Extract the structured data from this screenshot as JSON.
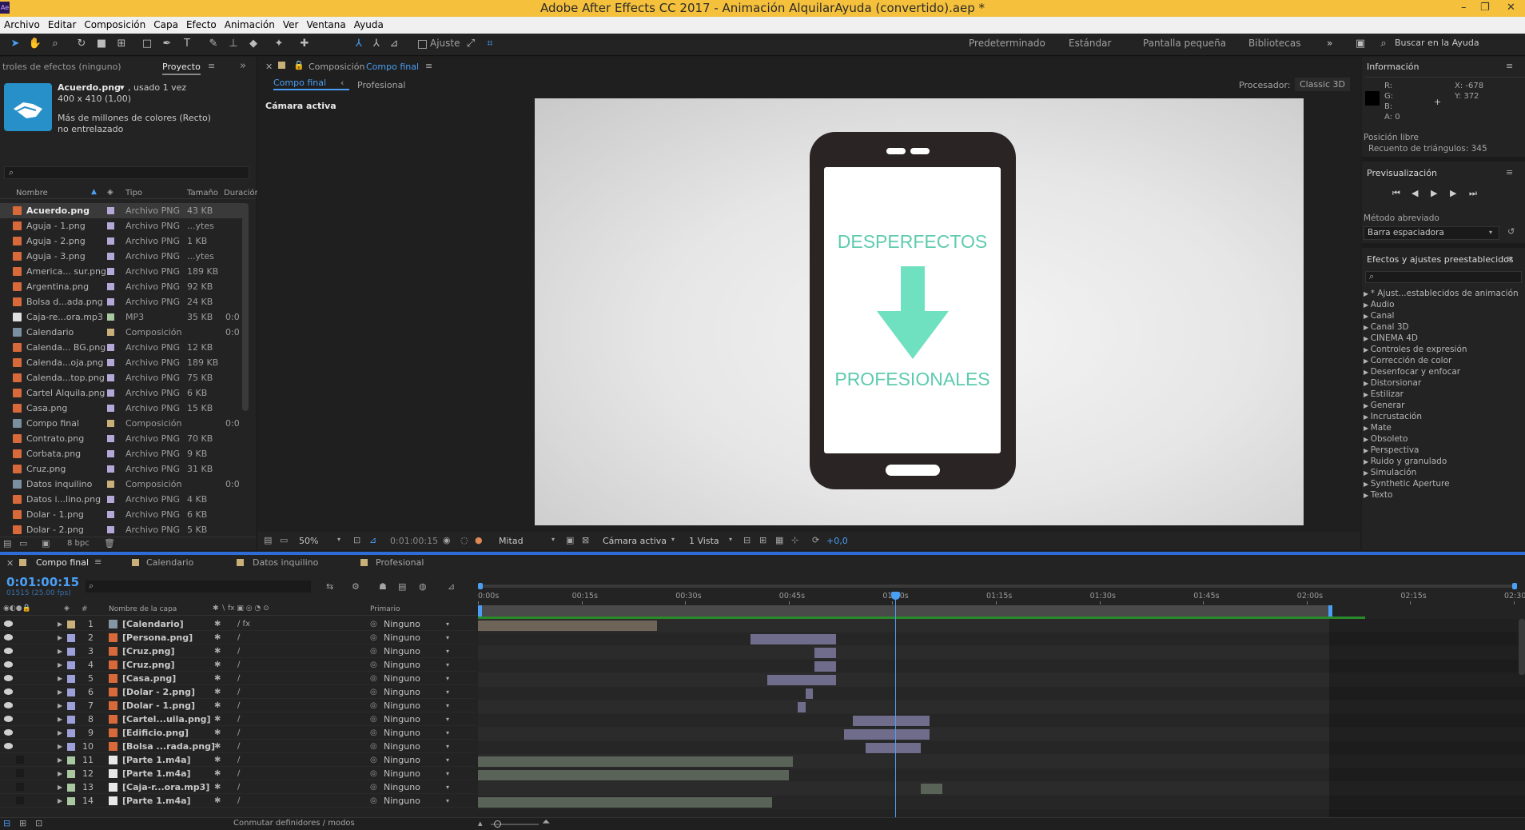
{
  "window": {
    "title": "Adobe After Effects CC 2017 - Animación AlquilarAyuda (convertido).aep *",
    "app_icon": "Ae"
  },
  "menu": [
    "Archivo",
    "Editar",
    "Composición",
    "Capa",
    "Efecto",
    "Animación",
    "Ver",
    "Ventana",
    "Ayuda"
  ],
  "toolbar": {
    "snap_label": "Ajuste",
    "workspaces": [
      "Predeterminado",
      "Estándar",
      "Pantalla pequeña",
      "Bibliotecas"
    ],
    "more": "»",
    "search_placeholder": "Buscar en la Ayuda"
  },
  "project_panel": {
    "tab_effects": "troles de efectos (ninguno)",
    "tab_project": "Proyecto",
    "preview_name": "Acuerdo.png",
    "preview_used": ", usado 1 vez",
    "preview_dims": "400 x 410 (1,00)",
    "preview_colors": "Más de millones de colores (Recto)",
    "preview_interlace": "no entrelazado",
    "columns": {
      "name": "Nombre",
      "type": "Tipo",
      "size": "Tamaño",
      "duration": "Duración"
    },
    "items": [
      {
        "name": "Acuerdo.png",
        "type": "Archivo PNG",
        "size": "43 KB",
        "dur": "",
        "kind": "png",
        "label": "#b4a8d8"
      },
      {
        "name": "Aguja - 1.png",
        "type": "Archivo PNG",
        "size": "...ytes",
        "dur": "",
        "kind": "png",
        "label": "#b4a8d8"
      },
      {
        "name": "Aguja - 2.png",
        "type": "Archivo PNG",
        "size": "1 KB",
        "dur": "",
        "kind": "png",
        "label": "#b4a8d8"
      },
      {
        "name": "Aguja - 3.png",
        "type": "Archivo PNG",
        "size": "...ytes",
        "dur": "",
        "kind": "png",
        "label": "#b4a8d8"
      },
      {
        "name": "America... sur.png",
        "type": "Archivo PNG",
        "size": "189 KB",
        "dur": "",
        "kind": "png",
        "label": "#b4a8d8"
      },
      {
        "name": "Argentina.png",
        "type": "Archivo PNG",
        "size": "92 KB",
        "dur": "",
        "kind": "png",
        "label": "#b4a8d8"
      },
      {
        "name": "Bolsa d...ada.png",
        "type": "Archivo PNG",
        "size": "24 KB",
        "dur": "",
        "kind": "png",
        "label": "#b4a8d8"
      },
      {
        "name": "Caja-re...ora.mp3",
        "type": "MP3",
        "size": "35 KB",
        "dur": "0:0",
        "kind": "mp3",
        "label": "#a8c8a0"
      },
      {
        "name": "Calendario",
        "type": "Composición",
        "size": "",
        "dur": "0:0",
        "kind": "comp",
        "label": "#c8b078"
      },
      {
        "name": "Calenda... BG.png",
        "type": "Archivo PNG",
        "size": "12 KB",
        "dur": "",
        "kind": "png",
        "label": "#b4a8d8"
      },
      {
        "name": "Calenda...oja.png",
        "type": "Archivo PNG",
        "size": "189 KB",
        "dur": "",
        "kind": "png",
        "label": "#b4a8d8"
      },
      {
        "name": "Calenda...top.png",
        "type": "Archivo PNG",
        "size": "75 KB",
        "dur": "",
        "kind": "png",
        "label": "#b4a8d8"
      },
      {
        "name": "Cartel Alquila.png",
        "type": "Archivo PNG",
        "size": "6 KB",
        "dur": "",
        "kind": "png",
        "label": "#b4a8d8"
      },
      {
        "name": "Casa.png",
        "type": "Archivo PNG",
        "size": "15 KB",
        "dur": "",
        "kind": "png",
        "label": "#b4a8d8"
      },
      {
        "name": "Compo final",
        "type": "Composición",
        "size": "",
        "dur": "0:0",
        "kind": "comp",
        "label": "#c8b078"
      },
      {
        "name": "Contrato.png",
        "type": "Archivo PNG",
        "size": "70 KB",
        "dur": "",
        "kind": "png",
        "label": "#b4a8d8"
      },
      {
        "name": "Corbata.png",
        "type": "Archivo PNG",
        "size": "9 KB",
        "dur": "",
        "kind": "png",
        "label": "#b4a8d8"
      },
      {
        "name": "Cruz.png",
        "type": "Archivo PNG",
        "size": "31 KB",
        "dur": "",
        "kind": "png",
        "label": "#b4a8d8"
      },
      {
        "name": "Datos inquilino",
        "type": "Composición",
        "size": "",
        "dur": "0:0",
        "kind": "comp",
        "label": "#c8b078"
      },
      {
        "name": "Datos i...lino.png",
        "type": "Archivo PNG",
        "size": "4 KB",
        "dur": "",
        "kind": "png",
        "label": "#b4a8d8"
      },
      {
        "name": "Dolar - 1.png",
        "type": "Archivo PNG",
        "size": "6 KB",
        "dur": "",
        "kind": "png",
        "label": "#b4a8d8"
      },
      {
        "name": "Dolar - 2.png",
        "type": "Archivo PNG",
        "size": "5 KB",
        "dur": "",
        "kind": "png",
        "label": "#b4a8d8"
      }
    ],
    "bpc": "8 bpc"
  },
  "composition": {
    "tab_label": "Composición",
    "tab_comp": "Compo final",
    "sub_tabs": [
      "Compo final",
      "Profesional"
    ],
    "renderer_label": "Procesador:",
    "renderer": "Classic 3D",
    "camera_label": "Cámara activa",
    "phone_text_top": "DESPERFECTOS",
    "phone_text_bottom": "PROFESIONALES",
    "accent_color": "#5ecbae",
    "footer": {
      "zoom": "50%",
      "timecode": "0:01:00:15",
      "resolution": "Mitad",
      "camera": "Cámara activa",
      "views": "1 Vista",
      "exposure": "+0,0"
    }
  },
  "info_panel": {
    "title": "Información",
    "r": "R:",
    "g": "G:",
    "b": "B:",
    "a": "A:  0",
    "x": "X: -678",
    "y": "Y: 372",
    "free_position": "Posición libre",
    "triangles": "Recuento de triángulos: 345"
  },
  "preview_panel": {
    "title": "Previsualización",
    "shortcut_label": "Método abreviado",
    "shortcut_value": "Barra espaciadora"
  },
  "effects_panel": {
    "title": "Efectos y ajustes preestablecidos",
    "items": [
      "* Ajust...establecidos de animación",
      "Audio",
      "Canal",
      "Canal 3D",
      "CINEMA 4D",
      "Controles de expresión",
      "Corrección de color",
      "Desenfocar y enfocar",
      "Distorsionar",
      "Estilizar",
      "Generar",
      "Incrustación",
      "Mate",
      "Obsoleto",
      "Perspectiva",
      "Ruido y granulado",
      "Simulación",
      "Synthetic Aperture",
      "Texto"
    ]
  },
  "timeline": {
    "tabs": [
      {
        "label": "Compo final",
        "color": "#c8b078"
      },
      {
        "label": "Calendario",
        "color": "#c8b078"
      },
      {
        "label": "Datos inquilino",
        "color": "#c8b078"
      },
      {
        "label": "Profesional",
        "color": "#c8b078"
      }
    ],
    "timecode": "0:01:00:15",
    "frames": "01515 (25.00 fps)",
    "col_layer_name": "Nombre de la capa",
    "col_parent": "Primario",
    "col_num": "#",
    "ruler": [
      "0:00s",
      "00:15s",
      "00:30s",
      "00:45s",
      "01:00s",
      "01:15s",
      "01:30s",
      "01:45s",
      "02:00s",
      "02:15s",
      "02:30"
    ],
    "layers": [
      {
        "n": "1",
        "name": "[Calendario]",
        "kind": "comp",
        "label": "#c8b078",
        "parent": "Ninguno",
        "vis": true,
        "fx": true,
        "bar": [
          0,
          0.21
        ],
        "barcolor": "#6e6457"
      },
      {
        "n": "2",
        "name": "[Persona.png]",
        "kind": "png",
        "label": "#9da0d8",
        "parent": "Ninguno",
        "vis": true,
        "bar": [
          0.32,
          0.1
        ],
        "barcolor": "#6f6d8b"
      },
      {
        "n": "3",
        "name": "[Cruz.png]",
        "kind": "png",
        "label": "#9da0d8",
        "parent": "Ninguno",
        "vis": true,
        "bar": [
          0.395,
          0.025
        ],
        "barcolor": "#6f6d8b"
      },
      {
        "n": "4",
        "name": "[Cruz.png]",
        "kind": "png",
        "label": "#9da0d8",
        "parent": "Ninguno",
        "vis": true,
        "bar": [
          0.395,
          0.025
        ],
        "barcolor": "#6f6d8b"
      },
      {
        "n": "5",
        "name": "[Casa.png]",
        "kind": "png",
        "label": "#9da0d8",
        "parent": "Ninguno",
        "vis": true,
        "bar": [
          0.34,
          0.08
        ],
        "barcolor": "#6f6d8b"
      },
      {
        "n": "6",
        "name": "[Dolar - 2.png]",
        "kind": "png",
        "label": "#9da0d8",
        "parent": "Ninguno",
        "vis": true,
        "bar": [
          0.385,
          0.008
        ],
        "barcolor": "#6f6d8b"
      },
      {
        "n": "7",
        "name": "[Dolar - 1.png]",
        "kind": "png",
        "label": "#9da0d8",
        "parent": "Ninguno",
        "vis": true,
        "bar": [
          0.375,
          0.01
        ],
        "barcolor": "#6f6d8b"
      },
      {
        "n": "8",
        "name": "[Cartel...uila.png]",
        "kind": "png",
        "label": "#9da0d8",
        "parent": "Ninguno",
        "vis": true,
        "bar": [
          0.44,
          0.09
        ],
        "barcolor": "#6f6d8b"
      },
      {
        "n": "9",
        "name": "[Edificio.png]",
        "kind": "png",
        "label": "#9da0d8",
        "parent": "Ninguno",
        "vis": true,
        "bar": [
          0.43,
          0.1
        ],
        "barcolor": "#6f6d8b"
      },
      {
        "n": "10",
        "name": "[Bolsa ...rada.png]",
        "kind": "png",
        "label": "#9da0d8",
        "parent": "Ninguno",
        "vis": true,
        "bar": [
          0.455,
          0.065
        ],
        "barcolor": "#6f6d8b"
      },
      {
        "n": "11",
        "name": "[Parte 1.m4a]",
        "kind": "audio",
        "label": "#a8c8a0",
        "parent": "Ninguno",
        "vis": false,
        "bar": [
          0,
          0.37
        ],
        "barcolor": "#5a6358"
      },
      {
        "n": "12",
        "name": "[Parte 1.m4a]",
        "kind": "audio",
        "label": "#a8c8a0",
        "parent": "Ninguno",
        "vis": false,
        "bar": [
          0,
          0.365
        ],
        "barcolor": "#5a6358"
      },
      {
        "n": "13",
        "name": "[Caja-r...ora.mp3]",
        "kind": "audio",
        "label": "#a8c8a0",
        "parent": "Ninguno",
        "vis": false,
        "bar": [
          0.52,
          0.025
        ],
        "barcolor": "#5a6358"
      },
      {
        "n": "14",
        "name": "[Parte 1.m4a]",
        "kind": "audio",
        "label": "#a8c8a0",
        "parent": "Ninguno",
        "vis": false,
        "bar": [
          0,
          0.345
        ],
        "barcolor": "#5a6358"
      }
    ],
    "footer_label": "Conmutar definidores / modos"
  }
}
